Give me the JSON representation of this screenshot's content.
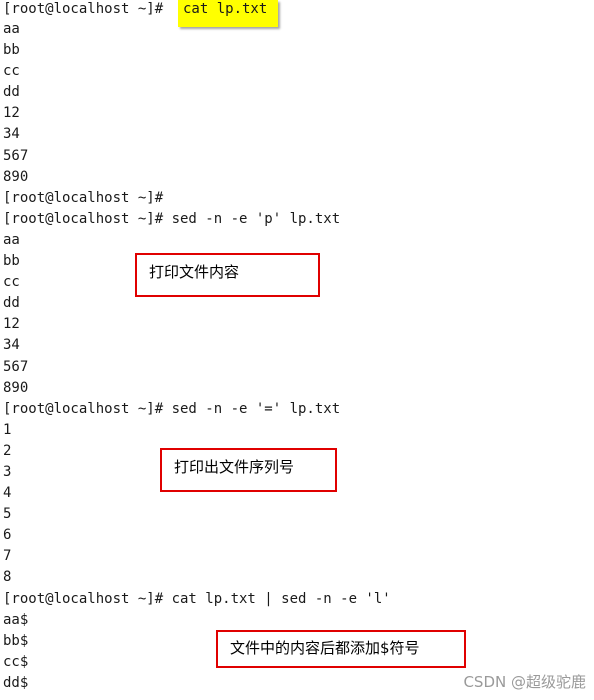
{
  "terminal": {
    "lines": [
      "[root@localhost ~]# ",
      "aa",
      "bb",
      "cc",
      "dd",
      "12",
      "34",
      "567",
      "890",
      "[root@localhost ~]#",
      "[root@localhost ~]# sed -n -e 'p' lp.txt",
      "aa",
      "bb",
      "cc",
      "dd",
      "12",
      "34",
      "567",
      "890",
      "[root@localhost ~]# sed -n -e '=' lp.txt",
      "1",
      "2",
      "3",
      "4",
      "5",
      "6",
      "7",
      "8",
      "[root@localhost ~]# cat lp.txt | sed -n -e 'l'",
      "aa$",
      "bb$",
      "cc$",
      "dd$"
    ],
    "highlighted_command": "cat lp.txt",
    "highlight_color": "#ffff00"
  },
  "annotations": [
    {
      "text": "打印文件内容",
      "border_color": "#e00000"
    },
    {
      "text": "打印出文件序列号",
      "border_color": "#e00000"
    },
    {
      "text": "文件中的内容后都添加$符号",
      "border_color": "#e00000"
    }
  ],
  "watermark": "CSDN @超级驼鹿"
}
